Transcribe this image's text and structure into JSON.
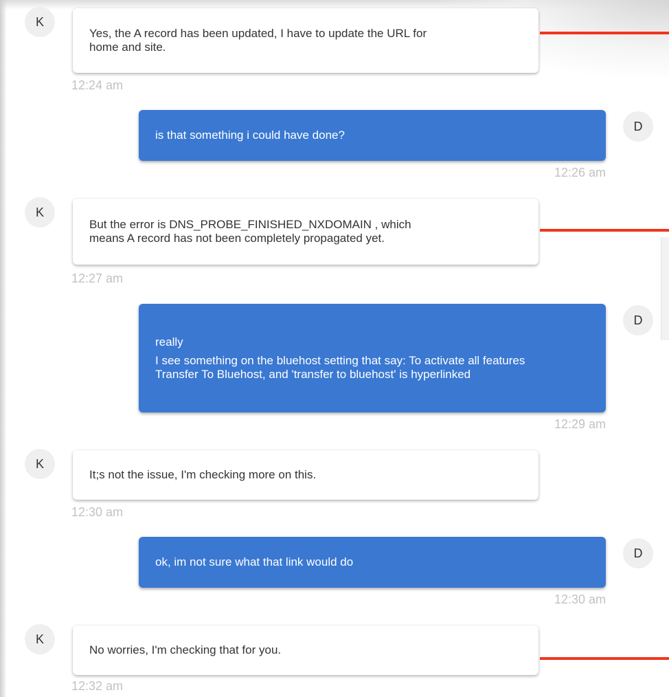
{
  "colors": {
    "user_bubble": "#3a78d2",
    "agent_bubble": "#ffffff",
    "timestamp": "#c2c2c2",
    "annotation_line": "#f0361d"
  },
  "avatars": {
    "agent_initial": "K",
    "user_initial": "D"
  },
  "messages": [
    {
      "sender": "agent",
      "lines": [
        "Yes, the A record has been updated, I have to update the URL for",
        "home and site."
      ],
      "time": "12:24 am"
    },
    {
      "sender": "user",
      "lines": [
        "is that something i could have done?"
      ],
      "time": "12:26 am"
    },
    {
      "sender": "agent",
      "lines": [
        "But the error is DNS_PROBE_FINISHED_NXDOMAIN , which",
        "means A record has not been completely propagated yet."
      ],
      "time": "12:27 am"
    },
    {
      "sender": "user",
      "lines": [
        "really",
        "I see something on the bluehost setting that say: To activate all features",
        "Transfer To Bluehost, and 'transfer to bluehost' is hyperlinked"
      ],
      "time": "12:29 am"
    },
    {
      "sender": "agent",
      "lines": [
        "It;s not the issue, I'm checking more on this."
      ],
      "time": "12:30 am"
    },
    {
      "sender": "user",
      "lines": [
        "ok, im not sure what that link would do"
      ],
      "time": "12:30 am"
    },
    {
      "sender": "agent",
      "lines": [
        "No worries, I'm checking that for you."
      ],
      "time": "12:32 am"
    }
  ]
}
